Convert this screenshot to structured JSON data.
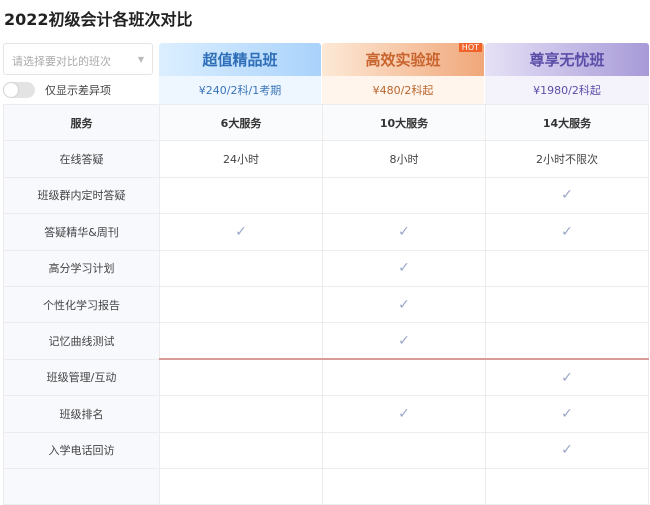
{
  "title": "2022初级会计各班次对比",
  "select": {
    "placeholder": "请选择要对比的班次"
  },
  "toggle": {
    "label": "仅显示差异项",
    "on": false
  },
  "plans": [
    {
      "name": "超值精品班",
      "price": "¥240/2科/1考期",
      "color": "#2f6fb8"
    },
    {
      "name": "高效实验班",
      "price": "¥480/2科起",
      "color": "#c8642e",
      "badge": "HOT"
    },
    {
      "name": "尊享无忧班",
      "price": "¥1980/2科起",
      "color": "#5b4ea8"
    }
  ],
  "header": {
    "label": "服务",
    "values": [
      "6大服务",
      "10大服务",
      "14大服务"
    ]
  },
  "check_symbol": "✓",
  "rows": [
    {
      "label": "在线答疑",
      "values": [
        "24小时",
        "8小时",
        "2小时不限次"
      ]
    },
    {
      "label": "班级群内定时答疑",
      "values": [
        "",
        "",
        "✓"
      ]
    },
    {
      "label": "答疑精华&周刊",
      "values": [
        "✓",
        "✓",
        "✓"
      ]
    },
    {
      "label": "高分学习计划",
      "values": [
        "",
        "✓",
        ""
      ]
    },
    {
      "label": "个性化学习报告",
      "values": [
        "",
        "✓",
        ""
      ]
    },
    {
      "label": "记忆曲线测试",
      "values": [
        "",
        "✓",
        ""
      ]
    },
    {
      "label": "班级管理/互动",
      "values": [
        "",
        "",
        "✓"
      ]
    },
    {
      "label": "班级排名",
      "values": [
        "",
        "✓",
        "✓"
      ]
    },
    {
      "label": "入学电话回访",
      "values": [
        "",
        "",
        "✓"
      ]
    },
    {
      "label": "",
      "values": [
        "",
        "",
        ""
      ]
    }
  ]
}
